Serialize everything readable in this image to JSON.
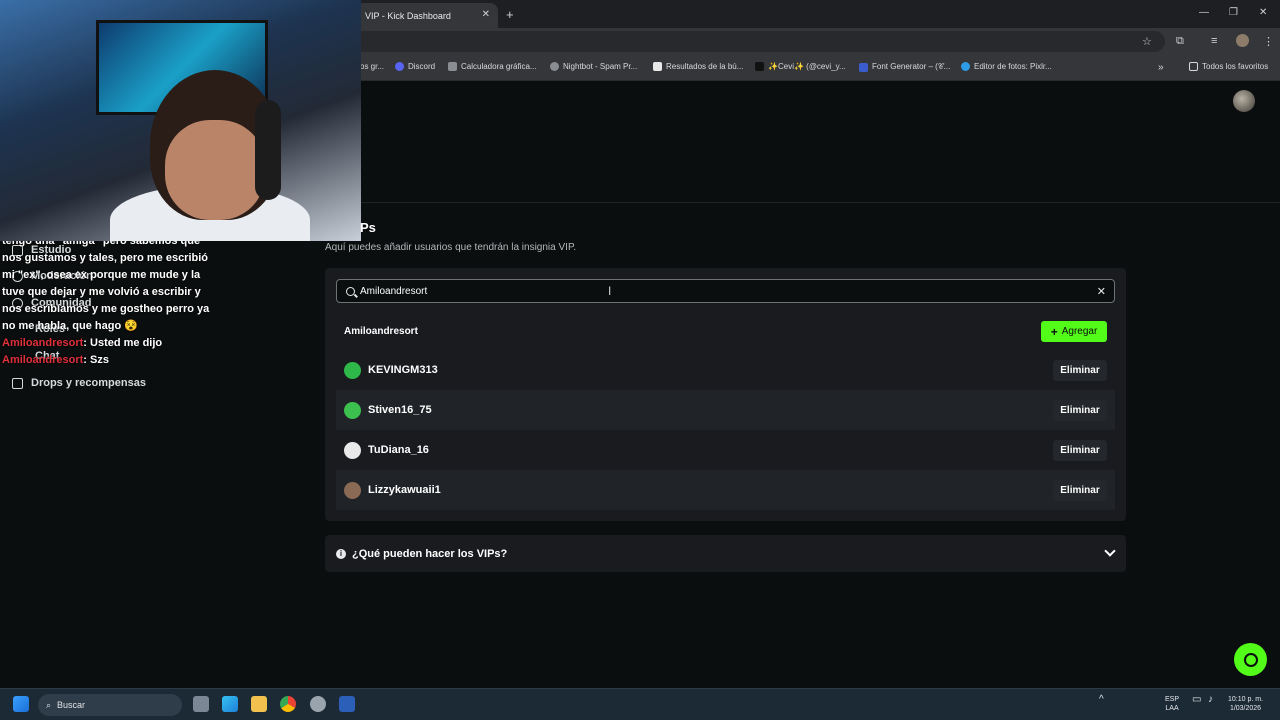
{
  "browser": {
    "tab_title": "VIP - Kick Dashboard",
    "close_glyph": "✕",
    "new_tab_glyph": "+",
    "window_controls": [
      "—",
      "❐",
      "✕"
    ],
    "bookmarks": [
      "os gr...",
      "Discord",
      "Calculadora gráfica...",
      "Nightbot - Spam Pr...",
      "Resultados de la bú...",
      "✨Cevi✨ (@cevi_y...",
      "Font Generator – (𝒞...",
      "Editor de fotos: Pixlr...",
      "Todos los favoritos"
    ]
  },
  "sidebar": {
    "items": [
      {
        "label": "Estudio",
        "icon": "studio-icon"
      },
      {
        "label": "Moderación",
        "icon": "sword-icon"
      },
      {
        "label": "Comunidad",
        "icon": "people-icon"
      },
      {
        "label": "Roles",
        "icon": "roles-icon"
      },
      {
        "label": "Chat",
        "icon": "chat-icon"
      },
      {
        "label": "Drops y recompensas",
        "icon": "gift-icon"
      }
    ]
  },
  "chat_overlay": {
    "lines": [
      "tengo una \"amiga\" pero sabemos que",
      "nos gustamos y tales, pero me escribió",
      "mi \"ex\", osea ex porque me mude y la",
      "tuve que dejar y me volvió a escribir y",
      "nos escribíamos y me gostheo perro ya",
      "no me habla, que hago 😵"
    ],
    "messages": [
      {
        "user": "Amiloandresort",
        "text": ": Usted me dijo"
      },
      {
        "user": "Amiloandresort",
        "text": ": Szs"
      }
    ]
  },
  "vips": {
    "title": "Ps",
    "subtitle": "Aquí puedes añadir usuarios que tendrán la insignia VIP.",
    "search_value": "Amiloandresort",
    "clear_glyph": "✕",
    "result_name": "Amiloandresort",
    "add_label": "Agregar",
    "remove_label": "Eliminar",
    "users": [
      {
        "name": "KEVINGM313",
        "avatar_color": "#2fb84a"
      },
      {
        "name": "Stiven16_75",
        "avatar_color": "#3cc04e"
      },
      {
        "name": "TuDiana_16",
        "avatar_color": "#e9e9e9"
      },
      {
        "name": "Lizzykawuaii1",
        "avatar_color": "#8a6a55"
      }
    ],
    "faq_label": "¿Qué pueden hacer los VIPs?"
  },
  "colors": {
    "accent": "#53fc18",
    "background": "#0b0e0f",
    "panel": "#191b1f",
    "chat_user": "#e0303a"
  },
  "taskbar": {
    "search_label": "Buscar",
    "language": "ESP",
    "layout": "LAA",
    "time": "10:10 p. m.",
    "date": "1/03/2026"
  }
}
